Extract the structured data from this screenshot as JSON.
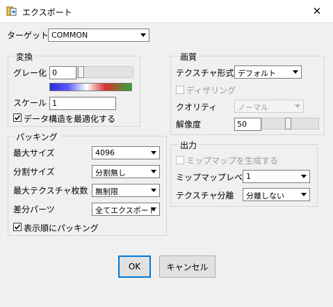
{
  "window": {
    "title": "エクスポート"
  },
  "target": {
    "label": "ターゲット",
    "value": "COMMON"
  },
  "transform": {
    "title": "変換",
    "grayscale_label": "グレー化",
    "grayscale_value": "0",
    "scale_label": "スケール",
    "scale_value": "1",
    "optimize_label": "データ構造を最適化する",
    "optimize_checked": true
  },
  "quality": {
    "title": "画質",
    "format_label": "テクスチャ形式",
    "format_value": "デフォルト",
    "dithering_label": "ディザリング",
    "dithering_checked": false,
    "quality_label": "クオリティ",
    "quality_value": "ノーマル",
    "resolution_label": "解像度",
    "resolution_value": "50"
  },
  "packing": {
    "title": "パッキング",
    "max_size_label": "最大サイズ",
    "max_size_value": "4096",
    "split_size_label": "分割サイズ",
    "split_size_value": "分割無し",
    "max_tex_label": "最大テクスチャ枚数",
    "max_tex_value": "無制限",
    "diff_parts_label": "差分パーツ",
    "diff_parts_value": "全てエクスポート",
    "display_order_label": "表示順にパッキング",
    "display_order_checked": true
  },
  "output": {
    "title": "出力",
    "mipmap_gen_label": "ミップマップを生成する",
    "mipmap_gen_checked": false,
    "mipmap_level_label": "ミップマップレベル",
    "mipmap_level_value": "1",
    "tex_split_label": "テクスチャ分離",
    "tex_split_value": "分離しない"
  },
  "buttons": {
    "ok": "OK",
    "cancel": "キャンセル"
  },
  "colors": {
    "accent": "#0078d7",
    "disabled": "#9a9a9a"
  }
}
